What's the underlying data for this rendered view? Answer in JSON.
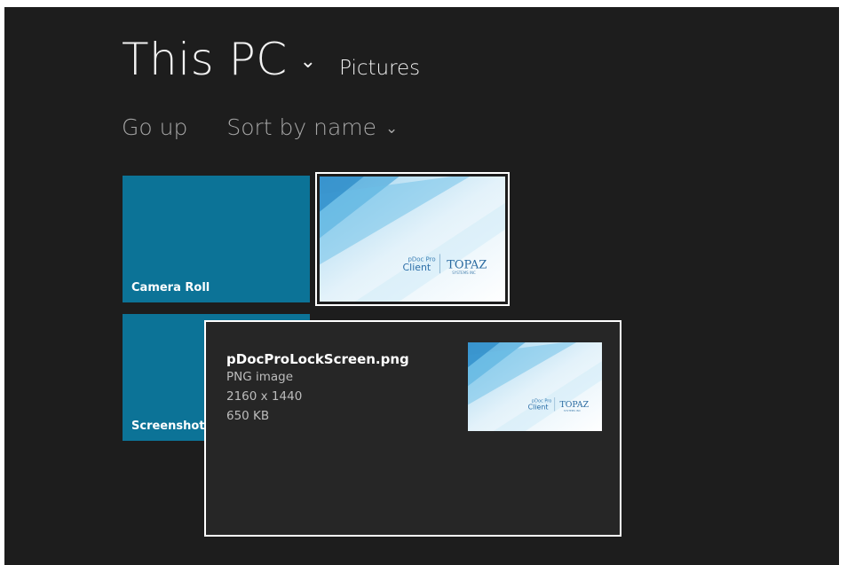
{
  "header": {
    "title": "This PC",
    "location": "Pictures"
  },
  "commands": {
    "go_up": "Go up",
    "sort": "Sort by name"
  },
  "folders": [
    {
      "label": "Camera Roll"
    },
    {
      "label": "Screenshots"
    }
  ],
  "thumbnail_text": {
    "product_small": "pDoc Pro",
    "product_big": "Client",
    "brand": "TOPAZ",
    "brand_sub": "SYSTEMS INC"
  },
  "tooltip": {
    "file_name": "pDocProLockScreen.png",
    "file_type": "PNG image",
    "dimensions": "2160 x 1440",
    "file_size": "650 KB"
  },
  "colors": {
    "background": "#1d1d1d",
    "tile": "#0c7397",
    "popup": "#262626"
  }
}
